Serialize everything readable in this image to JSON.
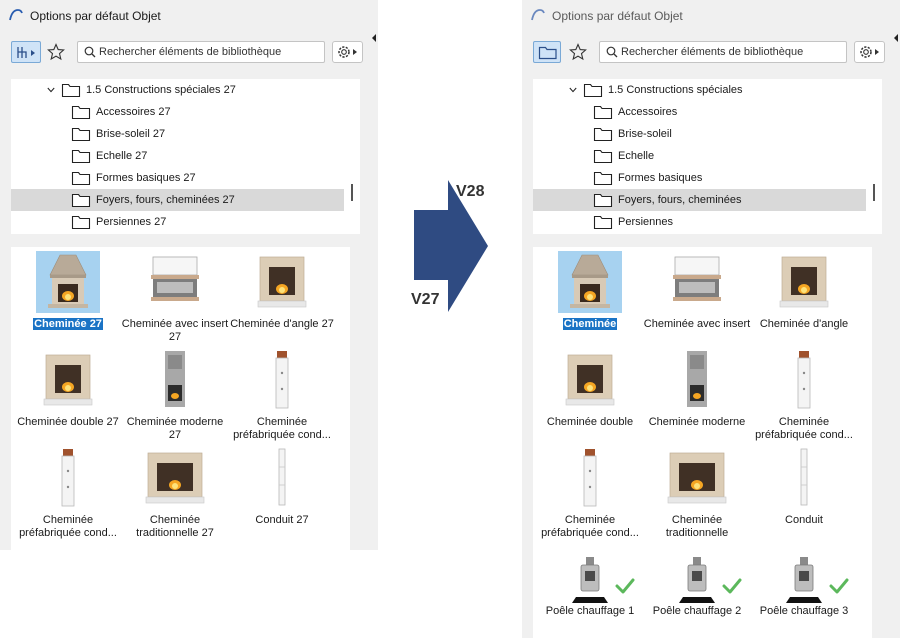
{
  "left": {
    "title": "Options par défaut Objet",
    "search_placeholder": "Rechercher éléments de bibliothèque",
    "tree": [
      {
        "label": "1.5 Constructions spéciales 27",
        "level": 0,
        "expanded": true,
        "selected": false
      },
      {
        "label": "Accessoires 27",
        "level": 1,
        "selected": false
      },
      {
        "label": "Brise-soleil 27",
        "level": 1,
        "selected": false
      },
      {
        "label": "Echelle 27",
        "level": 1,
        "selected": false
      },
      {
        "label": "Formes basiques 27",
        "level": 1,
        "selected": false
      },
      {
        "label": "Foyers, fours, cheminées 27",
        "level": 1,
        "selected": true
      },
      {
        "label": "Persiennes 27",
        "level": 1,
        "selected": false
      }
    ],
    "items": [
      {
        "label": "Cheminée 27",
        "icon": "fireplace-classic-icon",
        "selected": true
      },
      {
        "label": "Cheminée avec insert 27",
        "icon": "fireplace-insert-icon",
        "selected": false
      },
      {
        "label": "Cheminée d'angle 27",
        "icon": "fireplace-corner-icon",
        "selected": false
      },
      {
        "label": "Cheminée double 27",
        "icon": "fireplace-double-icon",
        "selected": false
      },
      {
        "label": "Cheminée moderne 27",
        "icon": "fireplace-modern-icon",
        "selected": false
      },
      {
        "label": "Cheminée préfabriquée cond...",
        "icon": "chimney-prefab-icon",
        "selected": false
      },
      {
        "label": "Cheminée préfabriquée cond...",
        "icon": "chimney-prefab-icon",
        "selected": false
      },
      {
        "label": "Cheminée traditionnelle 27",
        "icon": "fireplace-traditional-icon",
        "selected": false
      },
      {
        "label": "Conduit 27",
        "icon": "flue-pipe-icon",
        "selected": false
      }
    ]
  },
  "right": {
    "title": "Options par défaut Objet",
    "search_placeholder": "Rechercher éléments de bibliothèque",
    "tree": [
      {
        "label": "1.5 Constructions spéciales",
        "level": 0,
        "expanded": true,
        "selected": false
      },
      {
        "label": "Accessoires",
        "level": 1,
        "selected": false
      },
      {
        "label": "Brise-soleil",
        "level": 1,
        "selected": false
      },
      {
        "label": "Echelle",
        "level": 1,
        "selected": false
      },
      {
        "label": "Formes basiques",
        "level": 1,
        "selected": false
      },
      {
        "label": "Foyers, fours, cheminées",
        "level": 1,
        "selected": true
      },
      {
        "label": "Persiennes",
        "level": 1,
        "selected": false
      }
    ],
    "items": [
      {
        "label": "Cheminée",
        "icon": "fireplace-classic-icon",
        "selected": true
      },
      {
        "label": "Cheminée avec insert",
        "icon": "fireplace-insert-icon",
        "selected": false
      },
      {
        "label": "Cheminée d'angle",
        "icon": "fireplace-corner-icon",
        "selected": false
      },
      {
        "label": "Cheminée double",
        "icon": "fireplace-double-icon",
        "selected": false
      },
      {
        "label": "Cheminée moderne",
        "icon": "fireplace-modern-icon",
        "selected": false
      },
      {
        "label": "Cheminée préfabriquée cond...",
        "icon": "chimney-prefab-icon",
        "selected": false
      },
      {
        "label": "Cheminée préfabriquée cond...",
        "icon": "chimney-prefab-icon",
        "selected": false
      },
      {
        "label": "Cheminée traditionnelle",
        "icon": "fireplace-traditional-icon",
        "selected": false
      },
      {
        "label": "Conduit",
        "icon": "flue-pipe-icon",
        "selected": false
      },
      {
        "label": "Poêle chauffage 1",
        "icon": "stove-icon",
        "selected": false,
        "new": true
      },
      {
        "label": "Poêle chauffage 2",
        "icon": "stove-icon",
        "selected": false,
        "new": true
      },
      {
        "label": "Poêle chauffage 3",
        "icon": "stove-icon",
        "selected": false,
        "new": true
      }
    ]
  },
  "version_arrow": {
    "from": "V27",
    "to": "V28",
    "color": "#2f4b82"
  },
  "colors": {
    "selection": "#1a73c5",
    "thumb_selected": "#a7d2f0",
    "new_check": "#5cb85c"
  }
}
